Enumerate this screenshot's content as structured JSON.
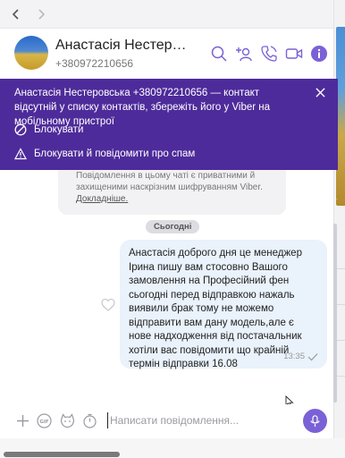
{
  "nav": {
    "back_icon": "chevron-left-icon",
    "forward_icon": "chevron-right-icon"
  },
  "header": {
    "name": "Анастасія Нестеровська",
    "phone": "+380972210656",
    "icons": [
      "search-icon",
      "add-participant-icon",
      "call-icon",
      "video-call-icon",
      "info-icon"
    ]
  },
  "banner": {
    "text": "Анастасія Нестеровська +380972210656 — контакт відсутній у списку контактів, збережіть його у Viber на мобільному пристрої",
    "block_label": "Блокувати",
    "report_label": "Блокувати й повідомити про спам",
    "background": "#4e2b9a"
  },
  "encryption": {
    "text": "Повідомлення в цьому чаті є приватними й захищеними наскрізним шифруванням Viber.",
    "link": "Докладніше."
  },
  "date_separator": "Сьогодні",
  "message": {
    "text": "Анастасія доброго дня це менеджер Ірина пишу вам стосовно Вашого замовлення на Професійний фен  сьогодні перед відправкою нажаль виявили брак тому не можемо відправити вам дану модель,але є нове надходження від постачальник хотіли вас повідомити що крайній термін відправки 16.08",
    "time": "13:35",
    "status_icon": "check-icon"
  },
  "composer": {
    "placeholder": "Написати повідомлення...",
    "icons": [
      "plus-icon",
      "gif-icon",
      "sticker-icon",
      "timer-icon",
      "microphone-icon"
    ],
    "accent": "#7b61d6"
  }
}
